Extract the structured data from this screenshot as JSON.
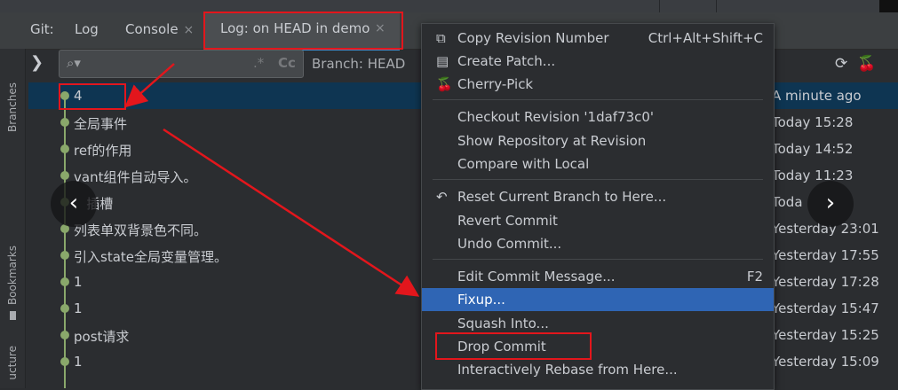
{
  "tabs": {
    "git_label": "Git:",
    "log": "Log",
    "console": "Console",
    "log_head": "Log: on HEAD in demo",
    "close_glyph": "×"
  },
  "side_labels": {
    "branches": "Branches",
    "bookmarks": "Bookmarks",
    "structure": "ucture"
  },
  "toolbar": {
    "search_placeholder": "",
    "regex_glyph": ".*",
    "case_glyph": "Cc",
    "branch_filter": "Branch: HEAD"
  },
  "commits": [
    {
      "message": "4",
      "date": "A minute ago"
    },
    {
      "message": "全局事件",
      "date": "Today 15:28"
    },
    {
      "message": "ref的作用",
      "date": "Today 14:52"
    },
    {
      "message": "vant组件自动导入。",
      "date": "Today 11:23"
    },
    {
      "message": "   插槽",
      "date": "Toda"
    },
    {
      "message": "列表单双背景色不同。",
      "date": "Yesterday 23:01"
    },
    {
      "message": "引入state全局变量管理。",
      "date": "Yesterday 17:55"
    },
    {
      "message": "1",
      "date": "Yesterday 17:28"
    },
    {
      "message": "1",
      "date": "Yesterday 15:47"
    },
    {
      "message": "post请求",
      "date": "Yesterday 15:25"
    },
    {
      "message": "1",
      "date": "Yesterday 15:09"
    }
  ],
  "context_menu": {
    "copy_revision": {
      "label": "Copy Revision Number",
      "shortcut": "Ctrl+Alt+Shift+C"
    },
    "create_patch": {
      "label": "Create Patch..."
    },
    "cherry_pick": {
      "label": "Cherry-Pick"
    },
    "checkout_revision": {
      "label": "Checkout Revision '1daf73c0'"
    },
    "show_repository": {
      "label": "Show Repository at Revision"
    },
    "compare_local": {
      "label": "Compare with Local"
    },
    "reset_branch": {
      "label": "Reset Current Branch to Here..."
    },
    "revert_commit": {
      "label": "Revert Commit"
    },
    "undo_commit": {
      "label": "Undo Commit..."
    },
    "edit_message": {
      "label": "Edit Commit Message...",
      "shortcut": "F2"
    },
    "fixup": {
      "label": "Fixup..."
    },
    "squash": {
      "label": "Squash Into..."
    },
    "drop_commit": {
      "label": "Drop Commit"
    },
    "rebase": {
      "label": "Interactively Rebase from Here..."
    }
  },
  "nav": {
    "prev": "‹",
    "next": "›"
  },
  "colors": {
    "selection": "#0e3552",
    "menu_highlight": "#2f65b4",
    "annotation": "#e3161c",
    "graph": "#8aa86b"
  },
  "icons": [
    "copy-icon",
    "patch-icon",
    "cherry-icon",
    "undo-icon",
    "refresh-icon",
    "search-icon"
  ]
}
